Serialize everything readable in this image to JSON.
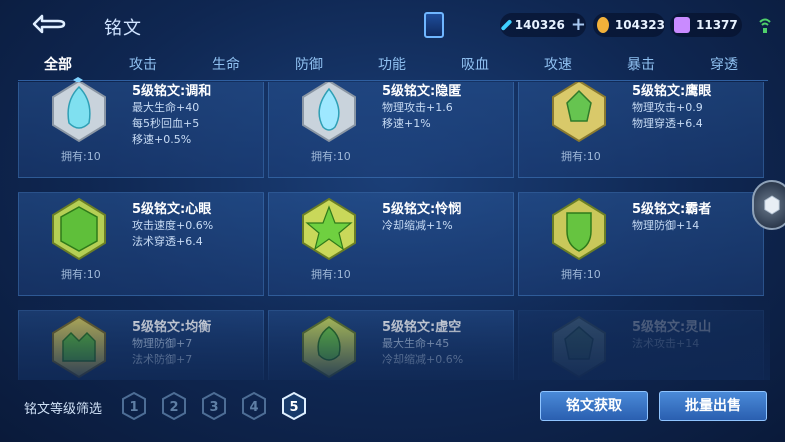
{
  "header": {
    "title": "铭文",
    "currencies": [
      {
        "name": "diamond",
        "value": "140326",
        "color": "#3fd0ff",
        "has_plus": true
      },
      {
        "name": "gold-coin",
        "value": "104323",
        "color": "#f2b13a",
        "has_plus": false
      },
      {
        "name": "gem",
        "value": "11377",
        "color": "#c98bff",
        "has_plus": false
      }
    ]
  },
  "tabs": [
    {
      "label": "全部",
      "active": true
    },
    {
      "label": "攻击"
    },
    {
      "label": "生命"
    },
    {
      "label": "防御"
    },
    {
      "label": "功能"
    },
    {
      "label": "吸血"
    },
    {
      "label": "攻速"
    },
    {
      "label": "暴击"
    },
    {
      "label": "穿透"
    }
  ],
  "cards": [
    {
      "name": "5级铭文:调和",
      "stats": [
        "最大生命+40",
        "每5秒回血+5",
        "移速+0.5%"
      ],
      "owned": "拥有:10",
      "gem": "silver-teal"
    },
    {
      "name": "5级铭文:隐匿",
      "stats": [
        "物理攻击+1.6",
        "移速+1%"
      ],
      "owned": "拥有:10",
      "gem": "silver-flame"
    },
    {
      "name": "5级铭文:鹰眼",
      "stats": [
        "物理攻击+0.9",
        "物理穿透+6.4"
      ],
      "owned": "拥有:10",
      "gem": "green-lotus"
    },
    {
      "name": "5级铭文:心眼",
      "stats": [
        "攻击速度+0.6%",
        "法术穿透+6.4"
      ],
      "owned": "拥有:10",
      "gem": "green-hex"
    },
    {
      "name": "5级铭文:怜悯",
      "stats": [
        "冷却缩减+1%"
      ],
      "owned": "拥有:10",
      "gem": "green-star"
    },
    {
      "name": "5级铭文:霸者",
      "stats": [
        "物理防御+14"
      ],
      "owned": "拥有:10",
      "gem": "green-shield"
    },
    {
      "name": "5级铭文:均衡",
      "stats": [
        "物理防御+7",
        "法术防御+7"
      ],
      "owned": "",
      "gem": "green-crown"
    },
    {
      "name": "5级铭文:虚空",
      "stats": [
        "最大生命+45",
        "冷却缩减+0.6%"
      ],
      "owned": "",
      "gem": "green-leaf"
    },
    {
      "name": "5级铭文:灵山",
      "stats": [
        "法术攻击+14"
      ],
      "owned": "",
      "gem": "green-dim"
    }
  ],
  "footer": {
    "filter_label": "铭文等级筛选",
    "levels": [
      "1",
      "2",
      "3",
      "4",
      "5"
    ],
    "selected_level": "5",
    "btn_obtain": "铭文获取",
    "btn_sell": "批量出售"
  }
}
